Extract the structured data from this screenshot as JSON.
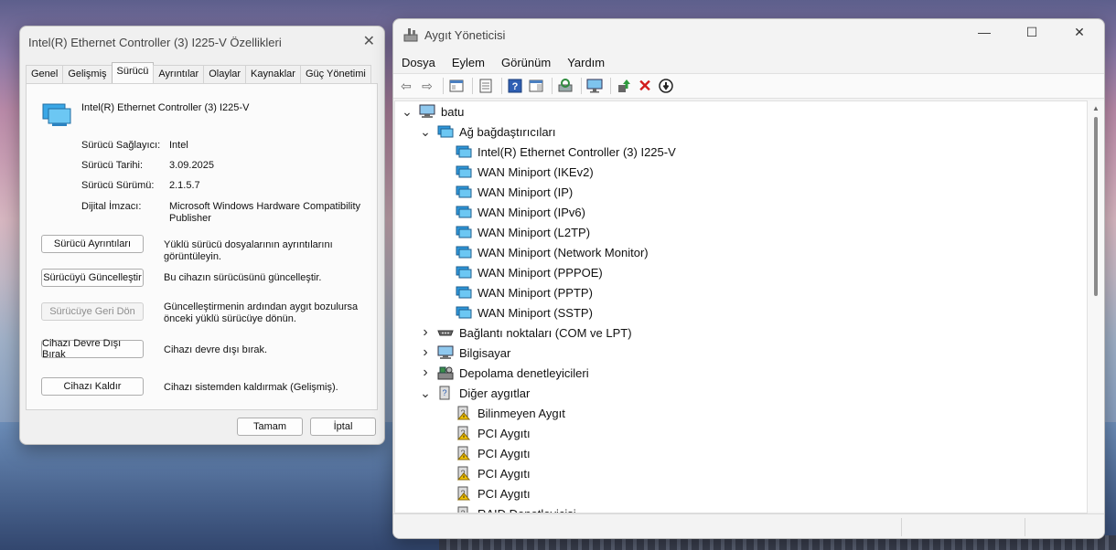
{
  "properties_dialog": {
    "title": "Intel(R) Ethernet Controller (3) I225-V Özellikleri",
    "tabs": [
      "Genel",
      "Gelişmiş",
      "Sürücü",
      "Ayrıntılar",
      "Olaylar",
      "Kaynaklar",
      "Güç Yönetimi"
    ],
    "active_tab": "Sürücü",
    "device_name": "Intel(R) Ethernet Controller (3) I225-V",
    "fields": [
      {
        "label": "Sürücü Sağlayıcı:",
        "value": "Intel"
      },
      {
        "label": "Sürücü Tarihi:",
        "value": "3.09.2025"
      },
      {
        "label": "Sürücü Sürümü:",
        "value": "2.1.5.7"
      },
      {
        "label": "Dijital İmzacı:",
        "value": "Microsoft Windows Hardware Compatibility Publisher"
      }
    ],
    "actions": [
      {
        "label": "Sürücü Ayrıntıları",
        "desc": "Yüklü sürücü dosyalarının ayrıntılarını görüntüleyin.",
        "enabled": true
      },
      {
        "label": "Sürücüyü Güncelleştir",
        "desc": "Bu cihazın sürücüsünü güncelleştir.",
        "enabled": true
      },
      {
        "label": "Sürücüye Geri Dön",
        "desc": "Güncelleştirmenin ardından aygıt bozulursa önceki yüklü sürücüye dönün.",
        "enabled": false
      },
      {
        "label": "Cihazı Devre Dışı Bırak",
        "desc": "Cihazı devre dışı bırak.",
        "enabled": true
      },
      {
        "label": "Cihazı Kaldır",
        "desc": "Cihazı sistemden kaldırmak (Gelişmiş).",
        "enabled": true
      }
    ],
    "ok_label": "Tamam",
    "cancel_label": "İptal"
  },
  "device_manager": {
    "title": "Aygıt Yöneticisi",
    "menus": [
      "Dosya",
      "Eylem",
      "Görünüm",
      "Yardım"
    ],
    "tree": [
      {
        "label": "batu",
        "level": 0,
        "expander": "open",
        "icon": "computer-icon"
      },
      {
        "label": "Ağ bağdaştırıcıları",
        "level": 1,
        "expander": "open",
        "icon": "network-adapter-icon"
      },
      {
        "label": "Intel(R) Ethernet Controller (3) I225-V",
        "level": 2,
        "expander": "none",
        "icon": "network-adapter-icon"
      },
      {
        "label": "WAN Miniport (IKEv2)",
        "level": 2,
        "expander": "none",
        "icon": "network-adapter-icon"
      },
      {
        "label": "WAN Miniport (IP)",
        "level": 2,
        "expander": "none",
        "icon": "network-adapter-icon"
      },
      {
        "label": "WAN Miniport (IPv6)",
        "level": 2,
        "expander": "none",
        "icon": "network-adapter-icon"
      },
      {
        "label": "WAN Miniport (L2TP)",
        "level": 2,
        "expander": "none",
        "icon": "network-adapter-icon"
      },
      {
        "label": "WAN Miniport (Network Monitor)",
        "level": 2,
        "expander": "none",
        "icon": "network-adapter-icon"
      },
      {
        "label": "WAN Miniport (PPPOE)",
        "level": 2,
        "expander": "none",
        "icon": "network-adapter-icon"
      },
      {
        "label": "WAN Miniport (PPTP)",
        "level": 2,
        "expander": "none",
        "icon": "network-adapter-icon"
      },
      {
        "label": "WAN Miniport (SSTP)",
        "level": 2,
        "expander": "none",
        "icon": "network-adapter-icon"
      },
      {
        "label": "Bağlantı noktaları (COM ve LPT)",
        "level": 1,
        "expander": "closed",
        "icon": "port-icon"
      },
      {
        "label": "Bilgisayar",
        "level": 1,
        "expander": "closed",
        "icon": "computer-icon"
      },
      {
        "label": "Depolama denetleyicileri",
        "level": 1,
        "expander": "closed",
        "icon": "storage-controller-icon"
      },
      {
        "label": "Diğer aygıtlar",
        "level": 1,
        "expander": "open",
        "icon": "unknown-device-icon"
      },
      {
        "label": "Bilinmeyen Aygıt",
        "level": 2,
        "expander": "none",
        "icon": "warning-device-icon"
      },
      {
        "label": "PCI Aygıtı",
        "level": 2,
        "expander": "none",
        "icon": "warning-device-icon"
      },
      {
        "label": "PCI Aygıtı",
        "level": 2,
        "expander": "none",
        "icon": "warning-device-icon"
      },
      {
        "label": "PCI Aygıtı",
        "level": 2,
        "expander": "none",
        "icon": "warning-device-icon"
      },
      {
        "label": "PCI Aygıtı",
        "level": 2,
        "expander": "none",
        "icon": "warning-device-icon"
      },
      {
        "label": "RAID Denetleyicisi",
        "level": 2,
        "expander": "none",
        "icon": "warning-device-icon"
      }
    ]
  }
}
